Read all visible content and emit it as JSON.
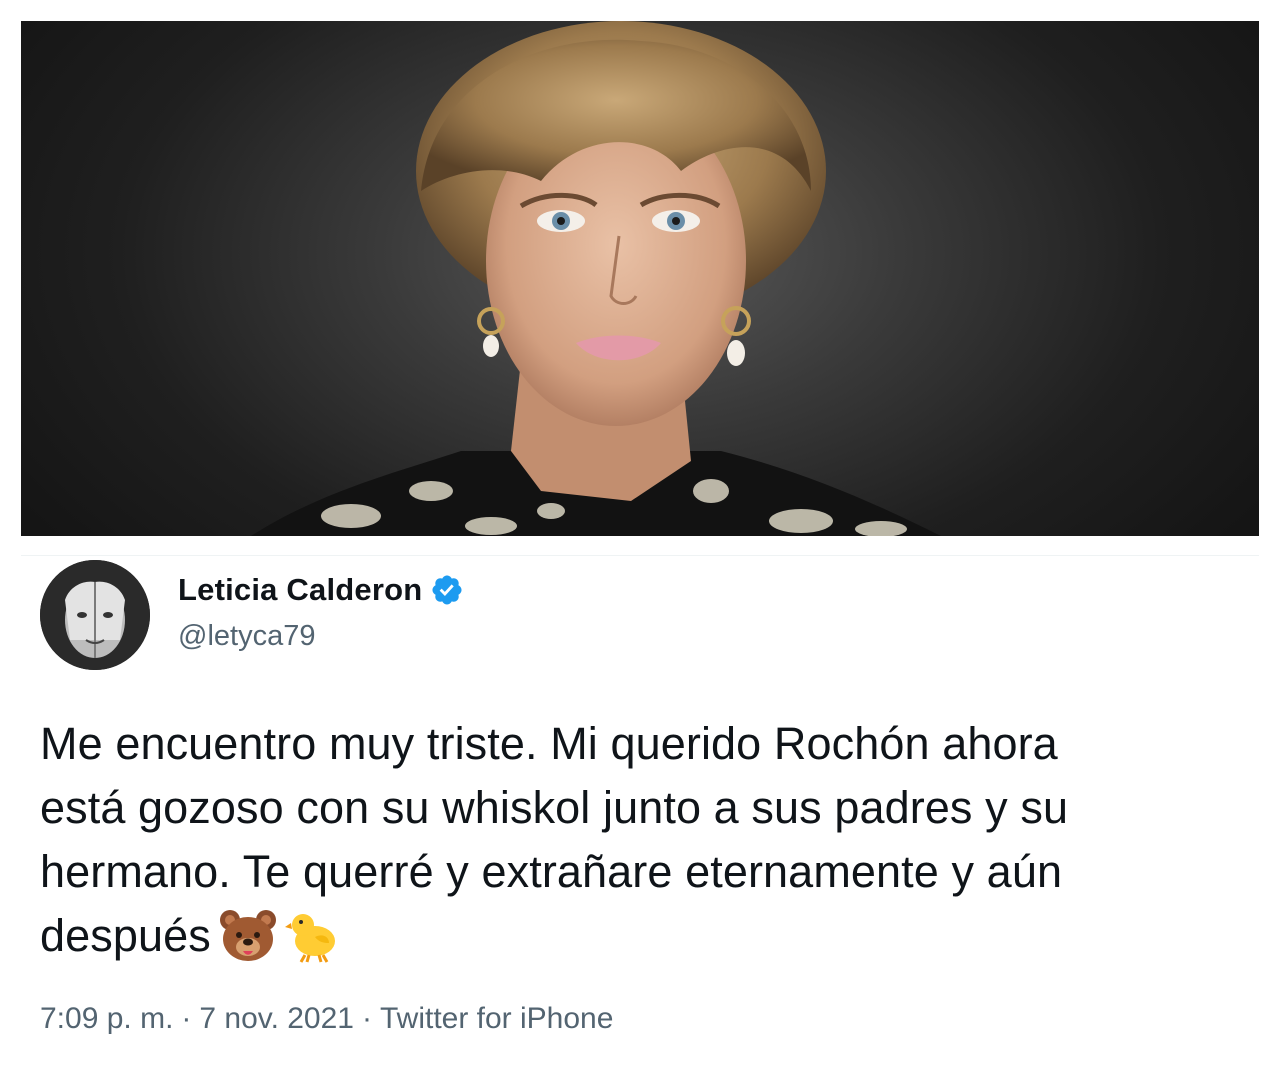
{
  "tweet": {
    "display_name": "Leticia Calderon",
    "handle": "@letyca79",
    "verified_icon": "verified-badge-icon",
    "text_lines": [
      "Me encuentro muy triste. Mi querido Rochón ahora",
      "está gozoso con su whiskol junto a sus padres y su",
      "hermano. Te querré y extrañare eternamente y aún",
      "después"
    ],
    "emojis": [
      "bear-face-emoji",
      "baby-chick-emoji"
    ],
    "time": "7:09 p. m.",
    "date": "7 nov. 2021",
    "source": "Twitter for iPhone",
    "separator": "·"
  },
  "colors": {
    "text_primary": "#0f1419",
    "text_secondary": "#536471",
    "verified_blue": "#1d9bf0"
  }
}
